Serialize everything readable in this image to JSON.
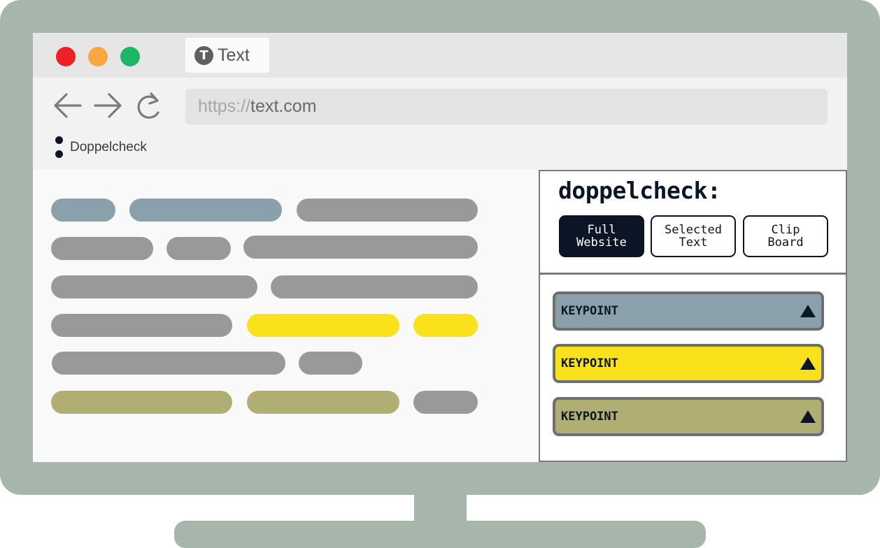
{
  "colors": {
    "monitor": "#a7b6aa",
    "traffic_red": "#ee2127",
    "traffic_yellow": "#f9a73e",
    "traffic_green": "#1eb564",
    "highlight_blue": "#8aa0aa",
    "highlight_yellow": "#f9e21c",
    "highlight_olive": "#b1ae74",
    "text_placeholder": "#999999",
    "dark_navy": "#0c1526"
  },
  "browser": {
    "tab": {
      "icon_letter": "T",
      "icon": "text-circle-icon",
      "label": "Text"
    },
    "nav": {
      "back_icon": "arrow-left-icon",
      "forward_icon": "arrow-right-icon",
      "reload_icon": "reload-icon"
    },
    "url": {
      "scheme": "https://",
      "host": "text.com"
    },
    "bookmark": {
      "icon": "doppelcheck-logo-icon",
      "label": "Doppelcheck"
    }
  },
  "extension": {
    "brand": "doppelcheck:",
    "modes": [
      {
        "label": "Full\nWebsite",
        "active": true
      },
      {
        "label": "Selected\nText",
        "active": false
      },
      {
        "label": "Clip\nBoard",
        "active": false
      }
    ],
    "keypoints": [
      {
        "label": "KEYPOINT",
        "color": "#8aa0aa",
        "icon": "triangle-up-icon"
      },
      {
        "label": "KEYPOINT",
        "color": "#f9e21c",
        "icon": "triangle-up-icon"
      },
      {
        "label": "KEYPOINT",
        "color": "#b1ae74",
        "icon": "triangle-up-icon"
      }
    ]
  }
}
